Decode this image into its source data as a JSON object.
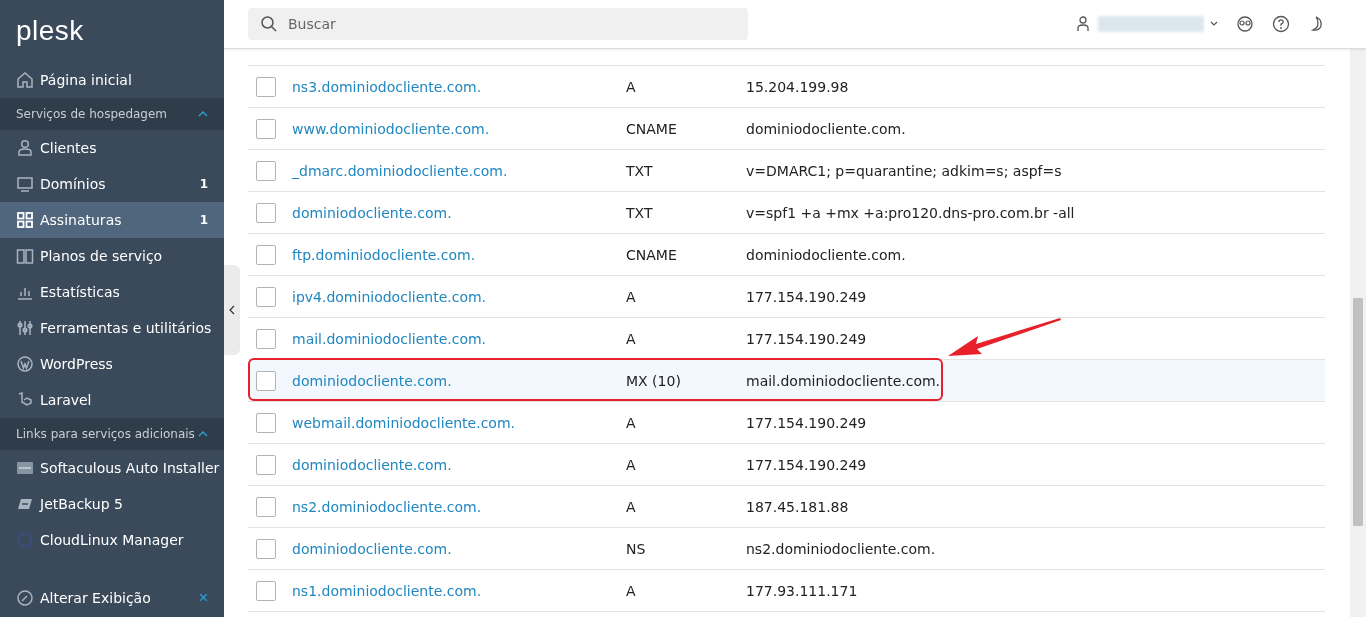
{
  "sidebar": {
    "logo": "plesk",
    "items": [
      {
        "kind": "item",
        "label": "Página inicial",
        "selected": false
      },
      {
        "kind": "section",
        "label": "Serviços de hospedagem",
        "expanded": true
      },
      {
        "kind": "item",
        "label": "Clientes",
        "selected": false
      },
      {
        "kind": "item",
        "label": "Domínios",
        "badge": "1",
        "selected": false
      },
      {
        "kind": "item",
        "label": "Assinaturas",
        "badge": "1",
        "selected": true
      },
      {
        "kind": "item",
        "label": "Planos de serviço",
        "selected": false
      },
      {
        "kind": "item",
        "label": "Estatísticas",
        "selected": false
      },
      {
        "kind": "item",
        "label": "Ferramentas e utilitários",
        "selected": false
      },
      {
        "kind": "item",
        "label": "WordPress",
        "selected": false
      },
      {
        "kind": "item",
        "label": "Laravel",
        "selected": false
      },
      {
        "kind": "section",
        "label": "Links para serviços adicionais",
        "expanded": true
      },
      {
        "kind": "item",
        "label": "Softaculous Auto Installer",
        "selected": false
      },
      {
        "kind": "item",
        "label": "JetBackup 5",
        "selected": false
      },
      {
        "kind": "item",
        "label": "CloudLinux Manager",
        "selected": false
      }
    ],
    "footer": {
      "label": "Alterar Exibição",
      "close": "×"
    }
  },
  "header": {
    "search": {
      "placeholder": "Buscar"
    }
  },
  "table": {
    "rows": [
      {
        "host": "ns3.dominiodocliente.com.",
        "type": "A",
        "value": "15.204.199.98",
        "checked": false,
        "highlighted": false
      },
      {
        "host": "www.dominiodocliente.com.",
        "type": "CNAME",
        "value": "dominiodocliente.com.",
        "checked": false,
        "highlighted": false
      },
      {
        "host": "_dmarc.dominiodocliente.com.",
        "type": "TXT",
        "value": "v=DMARC1; p=quarantine; adkim=s; aspf=s",
        "checked": false,
        "highlighted": false
      },
      {
        "host": "dominiodocliente.com.",
        "type": "TXT",
        "value": "v=spf1 +a +mx +a:pro120.dns-pro.com.br -all",
        "checked": false,
        "highlighted": false
      },
      {
        "host": "ftp.dominiodocliente.com.",
        "type": "CNAME",
        "value": "dominiodocliente.com.",
        "checked": false,
        "highlighted": false
      },
      {
        "host": "ipv4.dominiodocliente.com.",
        "type": "A",
        "value": "177.154.190.249",
        "checked": false,
        "highlighted": false
      },
      {
        "host": "mail.dominiodocliente.com.",
        "type": "A",
        "value": "177.154.190.249",
        "checked": false,
        "highlighted": false
      },
      {
        "host": "dominiodocliente.com.",
        "type": "MX (10)",
        "value": "mail.dominiodocliente.com.",
        "checked": false,
        "highlighted": true
      },
      {
        "host": "webmail.dominiodocliente.com.",
        "type": "A",
        "value": "177.154.190.249",
        "checked": false,
        "highlighted": false
      },
      {
        "host": "dominiodocliente.com.",
        "type": "A",
        "value": "177.154.190.249",
        "checked": false,
        "highlighted": false
      },
      {
        "host": "ns2.dominiodocliente.com.",
        "type": "A",
        "value": "187.45.181.88",
        "checked": false,
        "highlighted": false
      },
      {
        "host": "dominiodocliente.com.",
        "type": "NS",
        "value": "ns2.dominiodocliente.com.",
        "checked": false,
        "highlighted": false
      },
      {
        "host": "ns1.dominiodocliente.com.",
        "type": "A",
        "value": "177.93.111.171",
        "checked": false,
        "highlighted": false
      }
    ]
  }
}
